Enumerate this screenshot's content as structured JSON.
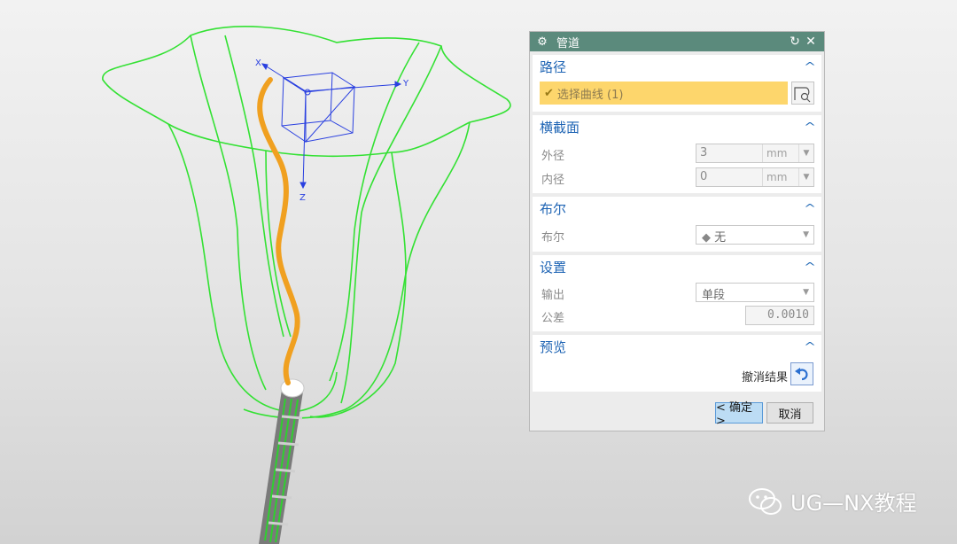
{
  "dialog": {
    "title": "管道",
    "groups": {
      "path": {
        "title": "路径",
        "select_curve": "选择曲线 (1)"
      },
      "section": {
        "title": "横截面",
        "outer_label": "外径",
        "outer_value": "3",
        "outer_unit": "mm",
        "inner_label": "内径",
        "inner_value": "0",
        "inner_unit": "mm"
      },
      "boolean": {
        "title": "布尔",
        "label": "布尔",
        "value": "无"
      },
      "settings": {
        "title": "设置",
        "output_label": "输出",
        "output_value": "单段",
        "tolerance_label": "公差",
        "tolerance_value": "0.0010"
      },
      "preview": {
        "title": "预览",
        "undo_label": "撤消结果"
      }
    },
    "ok_label": "< 确定 >",
    "cancel_label": "取消"
  },
  "triad": {
    "x": "X",
    "y": "Y",
    "z": "Z"
  },
  "watermark": "UG—NX教程",
  "colors": {
    "title_bar": "#5b8a7c",
    "group_title": "#1e64b4",
    "selection_highlight": "#fdd66c",
    "wireframe": "#33e133",
    "curve": "#f0a020",
    "triad": "#2a40e0"
  }
}
